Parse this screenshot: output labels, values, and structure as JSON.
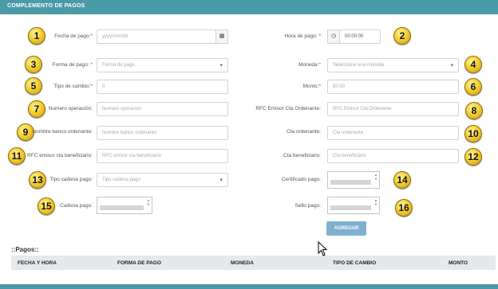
{
  "panel": {
    "title": "Complemento de pagos"
  },
  "colors": {
    "header": "#4a9aa8",
    "button": "#7fb1cf",
    "badge": "#f4cf2e"
  },
  "fields": {
    "fecha_pago": {
      "label": "Fecha de pago:",
      "placeholder": "yyyy/mm/dd",
      "icon": "calendar-icon",
      "badge": "1"
    },
    "hora_pago": {
      "label": "Hora de pago:",
      "value": "00:00:00",
      "icon": "clock-icon",
      "badge": "2"
    },
    "forma_pago": {
      "label": "Forma de pago:",
      "placeholder": "Forma de pago",
      "badge": "3"
    },
    "moneda": {
      "label": "Moneda:",
      "placeholder": "Seleccione una moneda",
      "badge": "4"
    },
    "tipo_cambio": {
      "label": "Tipo de cambio:",
      "value": "0",
      "badge": "5"
    },
    "monto": {
      "label": "Monto:",
      "value": "$0.00",
      "badge": "6"
    },
    "numero_operacion": {
      "label": "Numero operación:",
      "placeholder": "Numero operación",
      "badge": "7"
    },
    "rfc_emisor_ordenante": {
      "label": "RFC Emisor Cta Ordenante:",
      "placeholder": "RFC Emisor Cta Ordenante",
      "badge": "8"
    },
    "nombre_banco": {
      "label": "Nombre banco ordenante:",
      "placeholder": "Nombre banco ordenante",
      "badge": "9"
    },
    "cta_ordenante": {
      "label": "Cta ordenante:",
      "placeholder": "Cta ordenante",
      "badge": "10"
    },
    "rfc_emisor_beneficiario": {
      "label": "RFC emisor cta beneficiario:",
      "placeholder": "RFC emisor cta beneficiario",
      "badge": "11"
    },
    "cta_beneficiario": {
      "label": "Cta beneficiario:",
      "placeholder": "Cta beneficiario",
      "badge": "12"
    },
    "tipo_cadena": {
      "label": "Tipo cadena pago:",
      "placeholder": "Tipo cadena pago",
      "badge": "13"
    },
    "certificado_pago": {
      "label": "Certificado pago:",
      "badge": "14"
    },
    "cadena_pago": {
      "label": "Cadena pago:",
      "badge": "15"
    },
    "sello_pago": {
      "label": "Sello pago:",
      "badge": "16"
    }
  },
  "actions": {
    "agregar": "Agregar"
  },
  "pagos": {
    "title": "::Pagos::",
    "columns": [
      "Fecha y hora",
      "Forma de pago",
      "Moneda",
      "Tipo de cambio",
      "Monto"
    ]
  }
}
